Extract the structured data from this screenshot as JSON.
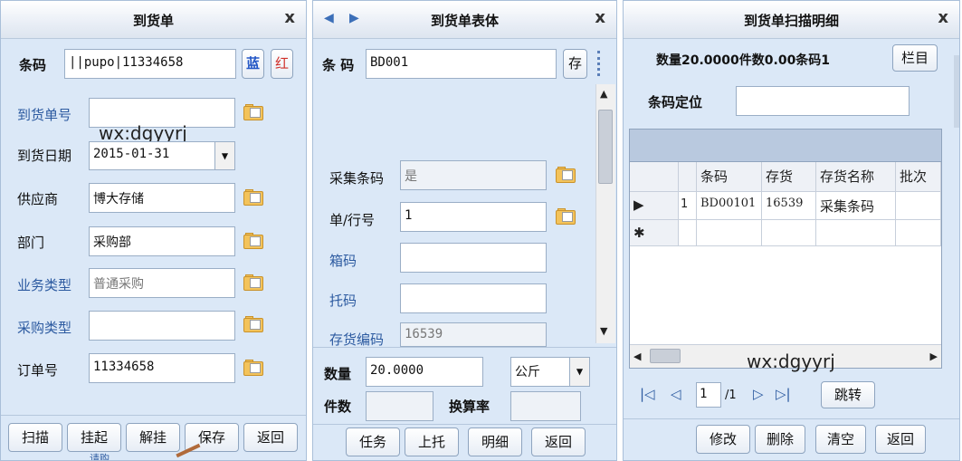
{
  "panel1": {
    "title": "到货单",
    "close": "x",
    "barcode": {
      "label": "条码",
      "value": "||pupo|11334658",
      "blue_btn": "蓝",
      "red_btn": "红"
    },
    "fields": [
      {
        "label": "到货单号",
        "value": ""
      },
      {
        "label": "到货日期",
        "value": "2015-01-31"
      },
      {
        "label": "供应商",
        "value": "博大存储"
      },
      {
        "label": "部门",
        "value": "采购部"
      },
      {
        "label": "业务类型",
        "value": "普通采购"
      },
      {
        "label": "采购类型",
        "value": ""
      },
      {
        "label": "订单号",
        "value": "11334658"
      }
    ],
    "watermark": "wx:dgyyrj",
    "buttons": [
      "扫描",
      "挂起",
      "解挂",
      "保存",
      "返回"
    ],
    "behind_text": "请购"
  },
  "panel2": {
    "title": "到货单表体",
    "close": "x",
    "barcode": {
      "label": "条 码",
      "value": "BD001",
      "save_btn": "存"
    },
    "fields": [
      {
        "label": "采集条码",
        "value": "是"
      },
      {
        "label": "单/行号",
        "value": "1"
      },
      {
        "label": "箱码",
        "value": ""
      },
      {
        "label": "托码",
        "value": ""
      },
      {
        "label": "存货编码",
        "value": "16539"
      }
    ],
    "qty": {
      "label": "数量",
      "value": "20.0000",
      "unit": "公斤"
    },
    "pieces": {
      "label": "件数",
      "value": ""
    },
    "rate": {
      "label": "换算率",
      "value": ""
    },
    "buttons": [
      "任务",
      "上托",
      "明细",
      "返回"
    ]
  },
  "panel3": {
    "title": "到货单扫描明细",
    "close": "x",
    "summary": "数量20.0000件数0.00条码1",
    "column_btn": "栏目",
    "locate_label": "条码定位",
    "locate_value": "",
    "grid": {
      "columns": [
        "条码",
        "存货",
        "存货名称",
        "批次"
      ],
      "rows": [
        {
          "indicator": "▶",
          "num": "1",
          "cells": [
            "BD00101",
            "16539",
            "采集条码",
            ""
          ]
        }
      ],
      "new_row": "✱"
    },
    "watermark": "wx:dgyyrj",
    "pager": {
      "page": "1",
      "total": "/1",
      "jump": "跳转"
    },
    "buttons": [
      "修改",
      "删除",
      "清空",
      "返回"
    ]
  },
  "colors": {
    "panel_bg": "#dbe8f7",
    "label_blue": "#2c5aa0",
    "folder": "#f3c35b",
    "red_btn": "#d0302a",
    "blue_btn": "#2357c6"
  }
}
